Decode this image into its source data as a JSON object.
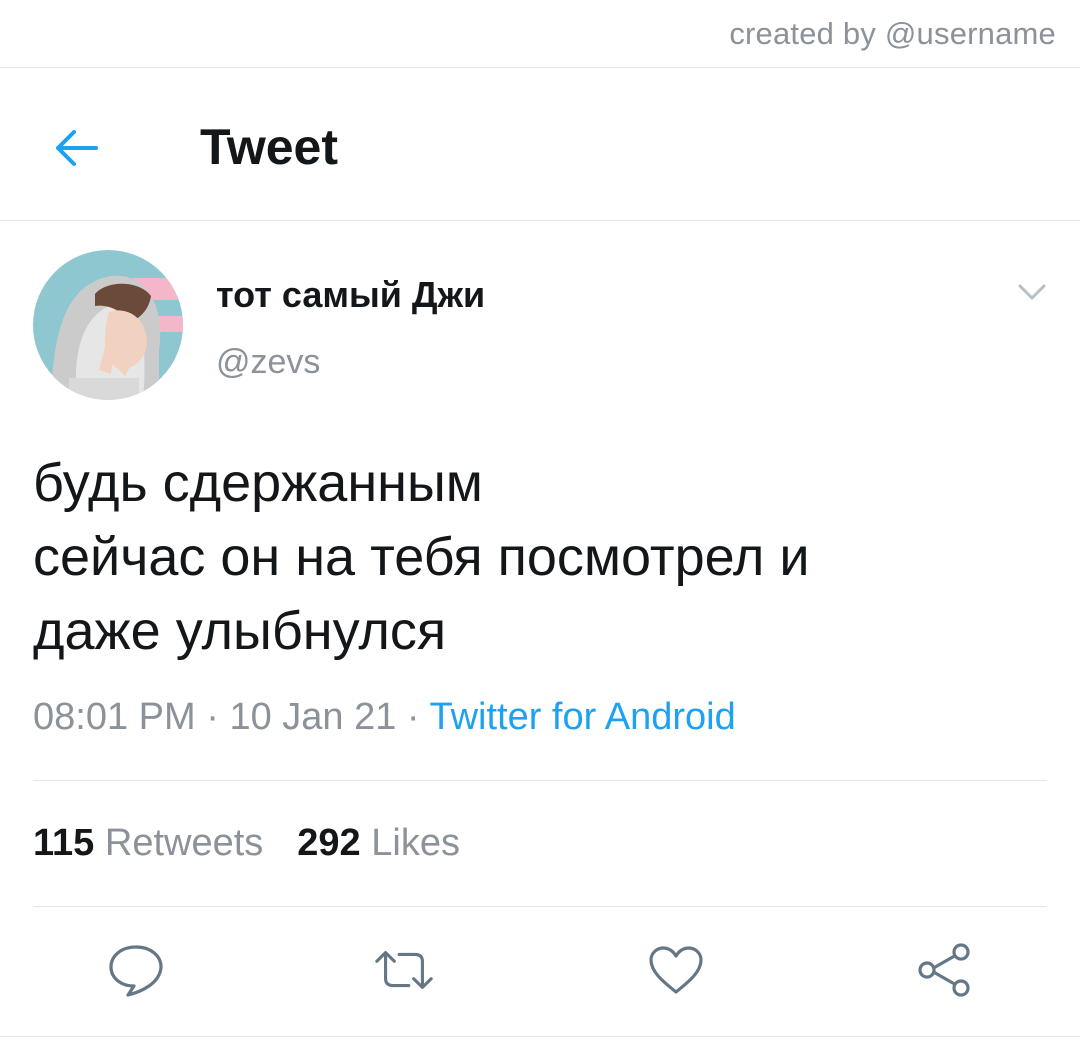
{
  "watermark": "created by @username",
  "header": {
    "back_icon": "arrow-left-icon",
    "title": "Tweet"
  },
  "colors": {
    "accent": "#1da1f2",
    "text": "#14171a",
    "muted": "#8b9299",
    "divider": "#e1e8ed"
  },
  "tweet": {
    "author": {
      "display_name": "тот самый Джи",
      "handle": "@zevs"
    },
    "menu_icon": "chevron-down-icon",
    "text_lines": [
      "будь сдержанным",
      "сейчас он на тебя посмотрел и",
      "даже улыбнулся"
    ],
    "time": "08:01 PM",
    "separator": " · ",
    "date": "10 Jan 21",
    "source": "Twitter for Android"
  },
  "stats": {
    "retweets_count": "115",
    "retweets_label": "Retweets",
    "likes_count": "292",
    "likes_label": "Likes"
  },
  "actions": [
    {
      "name": "reply",
      "icon": "speech-bubble-icon"
    },
    {
      "name": "retweet",
      "icon": "retweet-arrows-icon"
    },
    {
      "name": "like",
      "icon": "heart-icon"
    },
    {
      "name": "share",
      "icon": "share-nodes-icon"
    }
  ]
}
